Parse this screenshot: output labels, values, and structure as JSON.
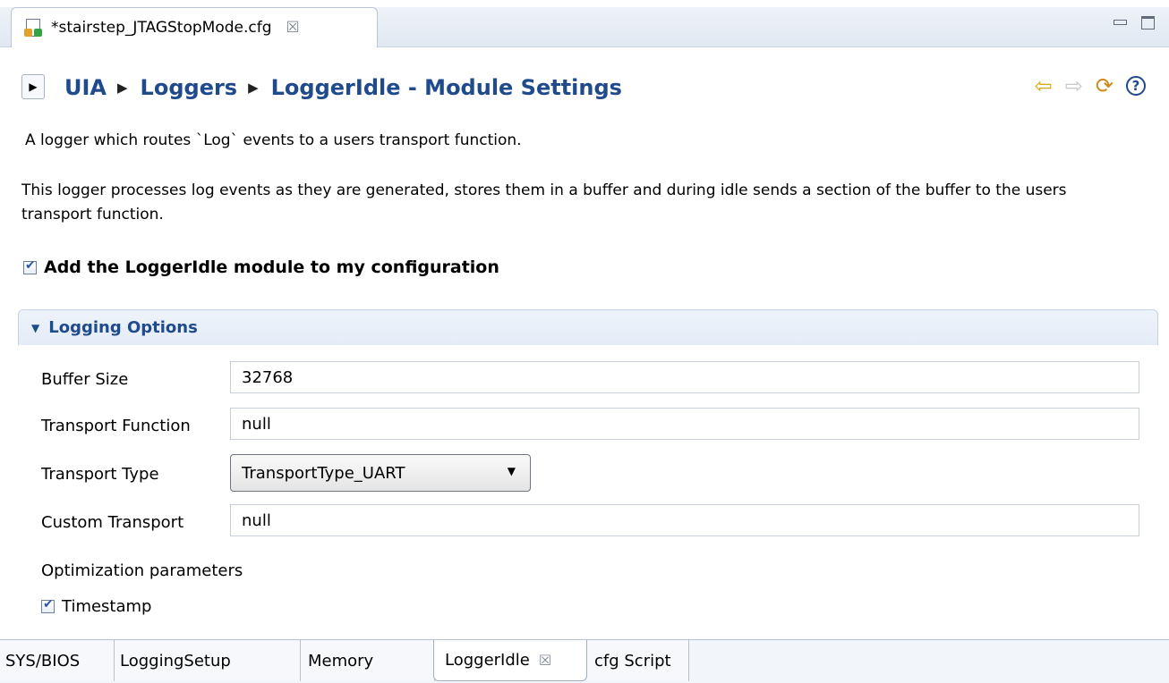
{
  "editor_tab": {
    "title": "*stairstep_JTAGStopMode.cfg",
    "icon": "cfg-file-icon",
    "close_icon": "close-icon"
  },
  "window_controls": {
    "minimize_icon": "minimize-icon",
    "maximize_icon": "maximize-icon"
  },
  "header": {
    "breadcrumb": [
      "UIA",
      "Loggers",
      "LoggerIdle - Module Settings"
    ],
    "nav_icons": [
      "back-arrow-icon",
      "forward-arrow-icon",
      "refresh-icon",
      "help-icon"
    ]
  },
  "description": {
    "line1": "A logger which routes `Log` events to a users transport function.",
    "line2": "This logger processes log events as they are generated, stores them in a buffer and during idle sends a section of the buffer to the users transport function."
  },
  "enable_module": {
    "label": "Add the LoggerIdle module to my configuration",
    "checked": true
  },
  "logging_options": {
    "title": "Logging Options",
    "buffer_size": {
      "label": "Buffer Size",
      "value": "32768"
    },
    "transport_function": {
      "label": "Transport Function",
      "value": "null"
    },
    "transport_type": {
      "label": "Transport Type",
      "value": "TransportType_UART"
    },
    "custom_transport": {
      "label": "Custom Transport",
      "value": "null"
    },
    "optimization_label": "Optimization parameters",
    "timestamp": {
      "label": "Timestamp",
      "checked": true
    }
  },
  "bottom_tabs": [
    {
      "label": "SYS/BIOS"
    },
    {
      "label": "LoggingSetup"
    },
    {
      "label": "Memory"
    },
    {
      "label": "LoggerIdle",
      "active": true
    },
    {
      "label": "cfg Script"
    }
  ],
  "colors": {
    "accent": "#1f4a8c",
    "nav_back": "#e3a514"
  }
}
